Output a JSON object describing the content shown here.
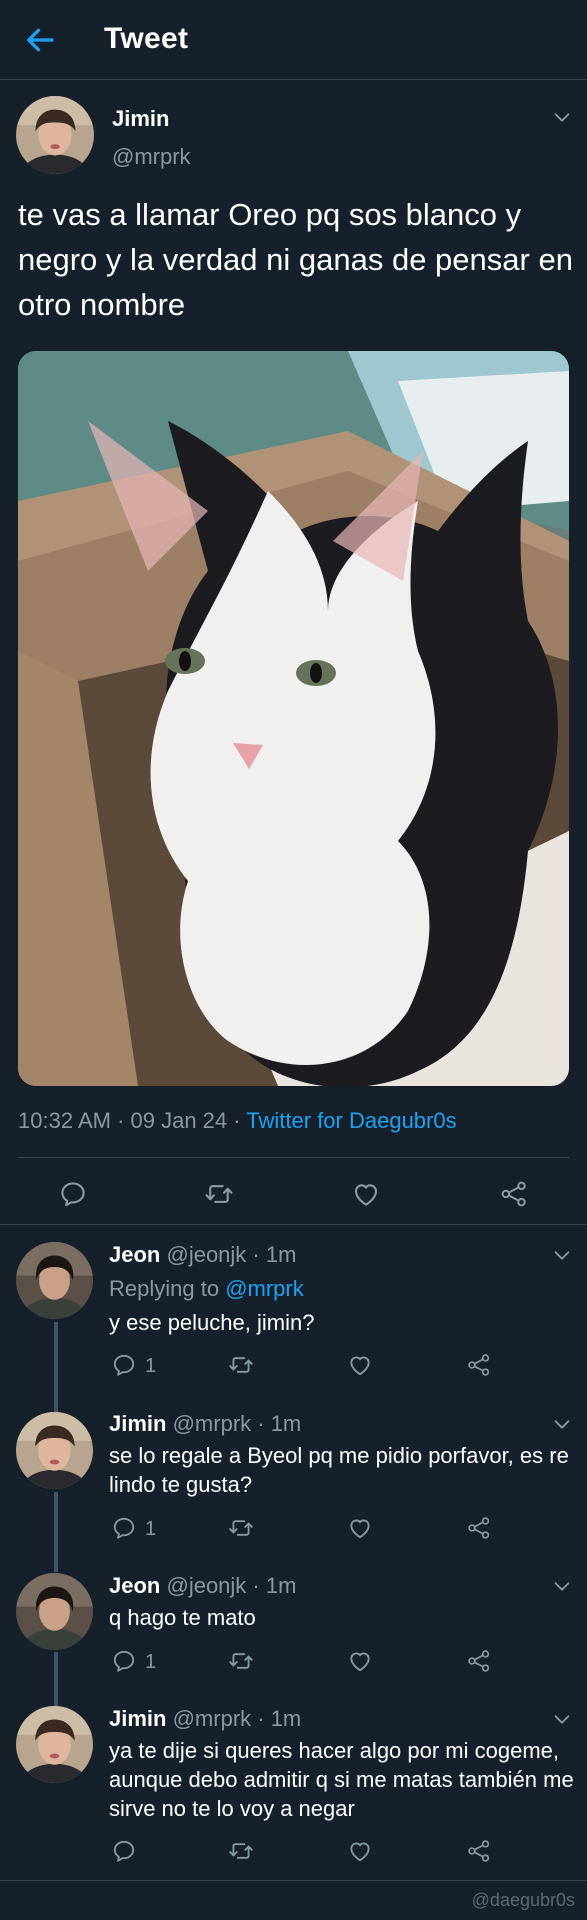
{
  "header": {
    "title": "Tweet"
  },
  "tweet": {
    "name": "Jimin",
    "handle": "@mrprk",
    "text": "te vas a llamar Oreo pq sos blanco y negro y la verdad ni ganas de pensar en otro nombre",
    "meta_time": "10:32 AM · 09 Jan 24 · ",
    "meta_source": "Twitter for Daegubr0s"
  },
  "replies": [
    {
      "name": "Jeon",
      "handle": "@jeonjk · 1m",
      "replying_prefix": "Replying to ",
      "replying_mention": "@mrprk",
      "text": "y ese peluche, jimin?",
      "reply_count": "1"
    },
    {
      "name": "Jimin",
      "handle": "@mrprk · 1m",
      "text": "se lo regale a Byeol pq me pidio porfavor, es re lindo te gusta?",
      "reply_count": "1"
    },
    {
      "name": "Jeon",
      "handle": "@jeonjk · 1m",
      "text": "q hago te mato",
      "reply_count": "1"
    },
    {
      "name": "Jimin",
      "handle": "@mrprk · 1m",
      "text": "ya te dije si queres hacer algo por mi cogeme, aunque debo admitir q si me matas también me sirve no te lo voy a negar",
      "reply_count": ""
    }
  ],
  "watermark": "@daegubr0s",
  "colors": {
    "background": "#15202b",
    "accent": "#1da1f2",
    "secondary_text": "#8899a6",
    "divider": "#38444d"
  },
  "icons": [
    "back-arrow-icon",
    "chevron-down-icon",
    "reply-icon",
    "retweet-icon",
    "like-icon",
    "share-icon"
  ]
}
